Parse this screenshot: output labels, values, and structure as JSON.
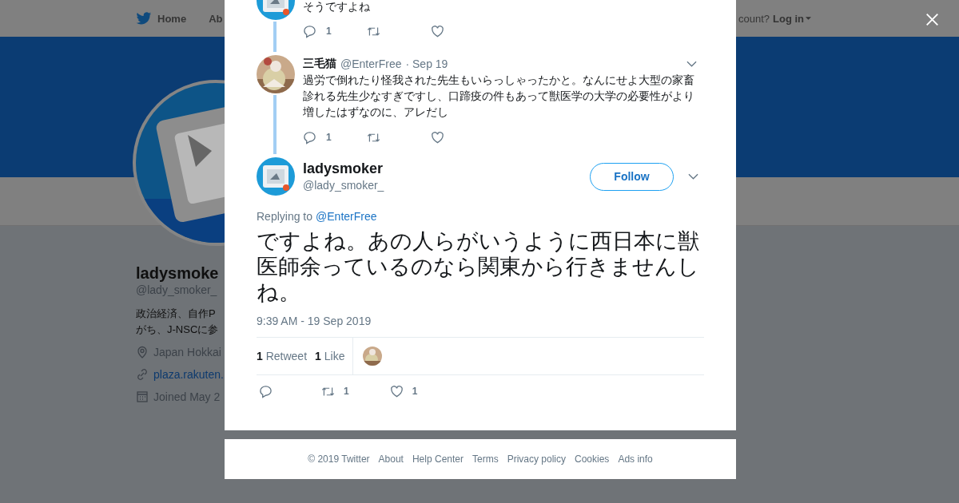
{
  "background_page": {
    "nav": {
      "items": [
        {
          "label": "Home"
        },
        {
          "label": "Ab"
        }
      ],
      "account_prompt": "count?",
      "login": "Log in"
    },
    "profile": {
      "name": "ladysmoke",
      "handle": "@lady_smoker_",
      "bio_lines": [
        "政治経済、自作P",
        "がち、J-NSCに参"
      ],
      "location": "Japan Hokkai",
      "link": "plaza.rakuten.",
      "joined": "Joined May 2"
    }
  },
  "thread": [
    {
      "kind": "cut",
      "text": "そうですよね",
      "reply_count": "1"
    },
    {
      "kind": "full",
      "name": "三毛猫",
      "handle": "@EnterFree",
      "date": "· Sep 19",
      "text": "過労で倒れたり怪我された先生もいらっしゃったかと。なんにせよ大型の家畜診れる先生少なすぎですし、口蹄疫の件もあって獣医学の大学の必要性がより増したはずなのに、アレだし",
      "reply_count": "1"
    }
  ],
  "main_tweet": {
    "name": "ladysmoker",
    "handle": "@lady_smoker_",
    "follow_label": "Follow",
    "replying_prefix": "Replying to",
    "replying_to": "@EnterFree",
    "text": "ですよね。あの人らがいうように西日本に獣医師余っているのなら関東から行きませんしね。",
    "timestamp": "9:39 AM - 19 Sep 2019",
    "retweets": "1",
    "retweets_label": "Retweet",
    "likes": "1",
    "likes_label": "Like",
    "retweet_count": "1",
    "like_count": "1"
  },
  "footer": [
    "© 2019 Twitter",
    "About",
    "Help Center",
    "Terms",
    "Privacy policy",
    "Cookies",
    "Ads info"
  ]
}
